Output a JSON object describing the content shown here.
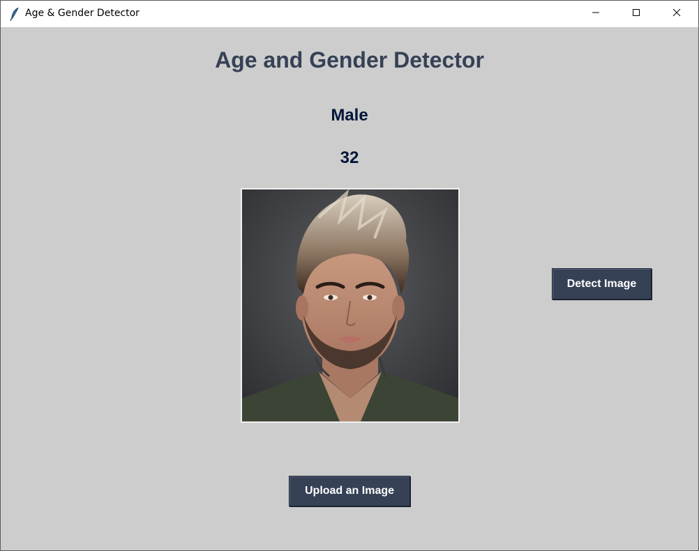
{
  "window": {
    "title": "Age & Gender Detector",
    "icon": "feather-icon",
    "controls": [
      "minimize-icon",
      "maximize-icon",
      "close-icon"
    ]
  },
  "main": {
    "heading": "Age and Gender Detector",
    "gender": "Male",
    "age": "32",
    "photo": "uploaded-face-photo"
  },
  "buttons": {
    "detect_label": "Detect Image",
    "upload_label": "Upload an Image"
  },
  "colors": {
    "background": "#cdcdcd",
    "heading": "#364156",
    "result_text": "#011638",
    "button_bg": "#364156",
    "button_text": "#ffffff"
  }
}
